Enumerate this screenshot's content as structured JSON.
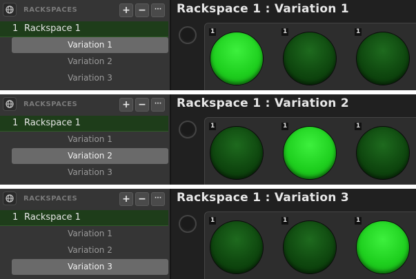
{
  "panels": [
    {
      "sidebar_title": "RACKSPACES",
      "rackspace": {
        "number": "1",
        "name": "Rackspace 1"
      },
      "variations": [
        "Variation 1",
        "Variation 2",
        "Variation 3"
      ],
      "selected_variation": 0,
      "title": "Rackspace 1 : Variation 1",
      "pads": [
        {
          "label": "1",
          "on": true
        },
        {
          "label": "1",
          "on": false
        },
        {
          "label": "1",
          "on": false
        }
      ]
    },
    {
      "sidebar_title": "RACKSPACES",
      "rackspace": {
        "number": "1",
        "name": "Rackspace 1"
      },
      "variations": [
        "Variation 1",
        "Variation 2",
        "Variation 3"
      ],
      "selected_variation": 1,
      "title": "Rackspace 1 : Variation 2",
      "pads": [
        {
          "label": "1",
          "on": false
        },
        {
          "label": "1",
          "on": true
        },
        {
          "label": "1",
          "on": false
        }
      ]
    },
    {
      "sidebar_title": "RACKSPACES",
      "rackspace": {
        "number": "1",
        "name": "Rackspace 1"
      },
      "variations": [
        "Variation 1",
        "Variation 2",
        "Variation 3"
      ],
      "selected_variation": 2,
      "title": "Rackspace 1 : Variation 3",
      "pads": [
        {
          "label": "1",
          "on": false
        },
        {
          "label": "1",
          "on": false
        },
        {
          "label": "1",
          "on": true
        }
      ]
    }
  ],
  "toolbar": {
    "add_label": "+",
    "remove_label": "−",
    "more_label": "···"
  },
  "icons": {
    "globe": "globe-icon"
  },
  "colors": {
    "pad_on": "#1fd01f",
    "pad_off": "#0f480f",
    "rackspace_row": "#1e3d1a"
  }
}
